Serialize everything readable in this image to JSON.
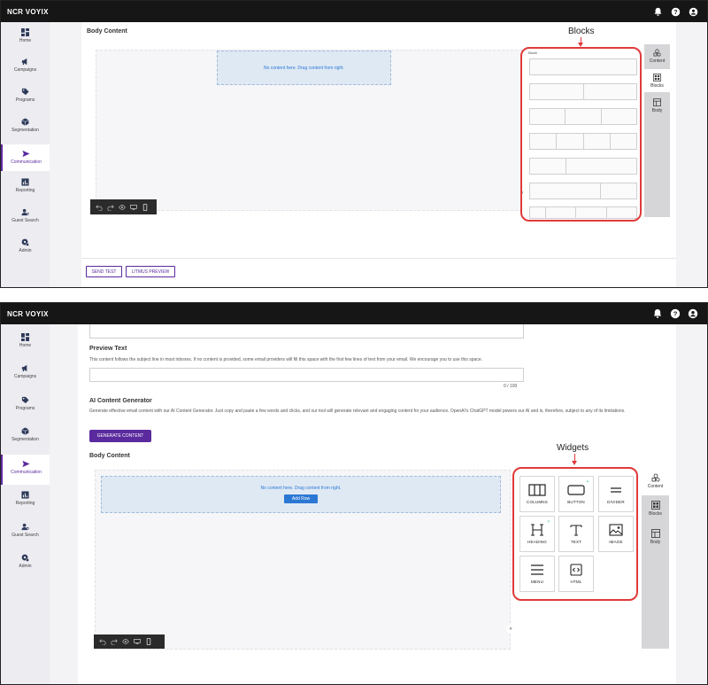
{
  "app": {
    "logo": "NCR VOYIX"
  },
  "nav": [
    {
      "label": "Home",
      "icon": "home-grid-icon"
    },
    {
      "label": "Campaigns",
      "icon": "megaphone-icon"
    },
    {
      "label": "Programs",
      "icon": "tag-icon"
    },
    {
      "label": "Segmentation",
      "icon": "cube-icon"
    },
    {
      "label": "Communication",
      "icon": "send-icon",
      "active": true
    },
    {
      "label": "Reporting",
      "icon": "chart-icon"
    },
    {
      "label": "Guest Search",
      "icon": "person-search-icon"
    },
    {
      "label": "Admin",
      "icon": "admin-gear-icon"
    }
  ],
  "panel1": {
    "section_title": "Body Content",
    "dropzone_text": "No content here. Drag content from right.",
    "callout": "Blocks",
    "blank_label": "Blank",
    "block_rows": [
      1,
      2,
      3,
      4,
      2,
      2,
      4
    ],
    "tabs": [
      {
        "label": "Content",
        "icon": "shapes-icon"
      },
      {
        "label": "Blocks",
        "icon": "blocks-icon",
        "active": true
      },
      {
        "label": "Body",
        "icon": "layout-icon"
      }
    ],
    "send_test": "SEND TEST",
    "litmus_preview": "LITMUS PREVIEW"
  },
  "panel2": {
    "preview_text_title": "Preview Text",
    "preview_text_desc": "This content follows the subject line in most inboxes. If no content is provided, some email providers will fill this space with the first few lines of text from your email. We encourage you to use this space.",
    "preview_counter": "0 / 100",
    "ai_title": "AI Content Generator",
    "ai_desc": "Generate effective email content with our AI Content Generator. Just copy and paste a few words and clicks, and our tool will generate relevant and engaging content for your audience. OpenAI's ChatGPT model powers our AI and is, therefore, subject to any of its limitations.",
    "generate_button": "GENERATE CONTENT",
    "section_title": "Body Content",
    "dropzone_text": "No content here. Drag content from right.",
    "add_row": "Add Row",
    "callout": "Widgets",
    "widgets": [
      {
        "label": "COLUMNS",
        "icon": "columns-icon"
      },
      {
        "label": "BUTTON",
        "icon": "button-icon",
        "ai": true
      },
      {
        "label": "DIVIDER",
        "icon": "divider-icon"
      },
      {
        "label": "HEADING",
        "icon": "heading-icon",
        "ai": true
      },
      {
        "label": "TEXT",
        "icon": "text-icon"
      },
      {
        "label": "IMAGE",
        "icon": "image-icon"
      },
      {
        "label": "MENU",
        "icon": "menu-icon"
      },
      {
        "label": "HTML",
        "icon": "html-icon"
      }
    ],
    "tabs": [
      {
        "label": "Content",
        "icon": "shapes-icon",
        "active": true
      },
      {
        "label": "Blocks",
        "icon": "blocks-icon"
      },
      {
        "label": "Body",
        "icon": "layout-icon"
      }
    ]
  },
  "colors": {
    "accent": "#5b2a9e",
    "link": "#2b78d4",
    "annotation": "#e03a3a"
  }
}
